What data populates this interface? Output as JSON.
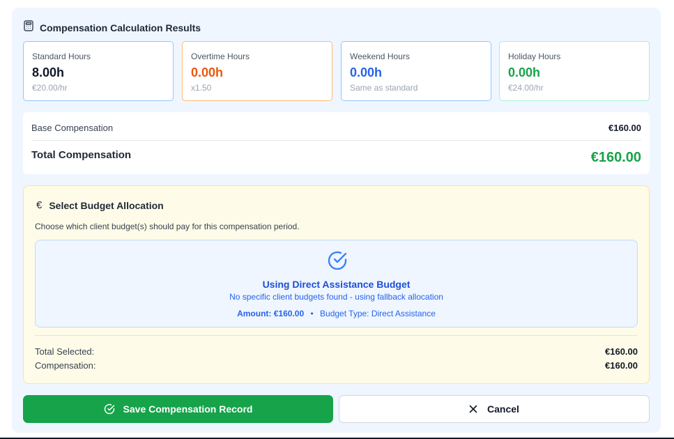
{
  "header": {
    "title": "Compensation Calculation Results",
    "icon": "calculator-icon"
  },
  "stats": [
    {
      "label": "Standard Hours",
      "value": "8.00h",
      "sub": "€20.00/hr",
      "color": "#111827",
      "border": "#93c5fd"
    },
    {
      "label": "Overtime Hours",
      "value": "0.00h",
      "sub": "x1.50",
      "color": "#ea580c",
      "border": "#fdba74"
    },
    {
      "label": "Weekend Hours",
      "value": "0.00h",
      "sub": "Same as standard",
      "color": "#2563eb",
      "border": "#93c5fd"
    },
    {
      "label": "Holiday Hours",
      "value": "0.00h",
      "sub": "€24.00/hr",
      "color": "#16a34a",
      "border": "#a7f3d0"
    }
  ],
  "summary": {
    "base_label": "Base Compensation",
    "base_value": "€160.00",
    "total_label": "Total Compensation",
    "total_value": "€160.00"
  },
  "budget": {
    "title": "Select Budget Allocation",
    "euro_symbol": "€",
    "description": "Choose which client budget(s) should pay for this compensation period.",
    "direct": {
      "title": "Using Direct Assistance Budget",
      "subtitle": "No specific client budgets found - using fallback allocation",
      "amount": "Amount: €160.00",
      "separator": "•",
      "type": "Budget Type: Direct Assistance"
    },
    "total_selected_label": "Total Selected:",
    "total_selected_value": "€160.00",
    "compensation_label": "Compensation:",
    "compensation_value": "€160.00"
  },
  "actions": {
    "save_label": "Save Compensation Record",
    "cancel_label": "Cancel"
  }
}
